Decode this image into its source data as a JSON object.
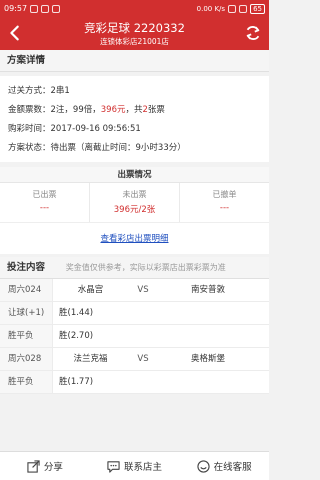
{
  "status_bar": {
    "time": "09:57",
    "right_info": "0.00 K/s",
    "battery": "65"
  },
  "header": {
    "title": "竞彩足球  2220332",
    "subtitle": "连锁体彩店21001店"
  },
  "plan_details": {
    "heading": "方案详情",
    "pass_label": "过关方式：",
    "pass_value": "2串1",
    "amount_label": "金额票数：",
    "amount_part1": "2注，99倍，",
    "amount_money": "396元",
    "amount_part2": "，共",
    "amount_tickets": "2",
    "amount_part3": "张票",
    "time_label": "购彩时间：",
    "time_value": "2017-09-16 09:56:51",
    "status_label": "方案状态：",
    "status_value": "待出票（离截止时间：9小时33分）"
  },
  "ticket_status": {
    "title": "出票情况",
    "columns": [
      {
        "label": "已出票",
        "value": "---"
      },
      {
        "label": "未出票",
        "value": "396元/2张"
      },
      {
        "label": "已撤单",
        "value": "---"
      }
    ],
    "detail_link": "查看彩店出票明细"
  },
  "bet_content": {
    "heading": "投注内容",
    "note": "奖金值仅供参考，实际以彩票店出票彩票为准",
    "matches": [
      {
        "code": "周六024",
        "home": "水晶宫",
        "vs": "VS",
        "away": "南安普敦",
        "selections": [
          {
            "label": "让球(+1)",
            "value": "胜(1.44)"
          },
          {
            "label": "胜平负",
            "value": "胜(2.70)"
          }
        ]
      },
      {
        "code": "周六028",
        "home": "法兰克福",
        "vs": "VS",
        "away": "奥格斯堡",
        "selections": [
          {
            "label": "胜平负",
            "value": "胜(1.77)"
          }
        ]
      }
    ]
  },
  "bottom_bar": {
    "share": "分享",
    "contact": "联系店主",
    "service": "在线客服"
  },
  "colors": {
    "brand_red": "#d12f2f",
    "link_blue": "#1f4fbf"
  }
}
